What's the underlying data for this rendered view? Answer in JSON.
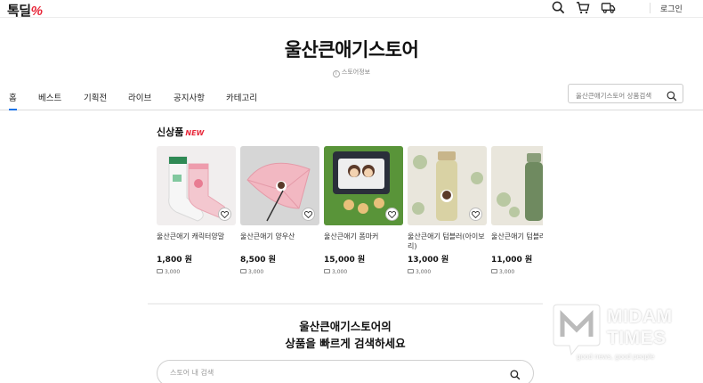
{
  "header": {
    "logo_text": "톡딜",
    "logo_mark": "%",
    "login_label": "로그인",
    "icons": [
      "search-icon",
      "cart-icon",
      "delivery-truck-icon"
    ]
  },
  "store": {
    "title": "울산큰애기스토어",
    "info_label": "스토어정보"
  },
  "nav": {
    "tabs": [
      {
        "label": "홈",
        "active": true
      },
      {
        "label": "베스트"
      },
      {
        "label": "기획전"
      },
      {
        "label": "라이브"
      },
      {
        "label": "공지사항"
      },
      {
        "label": "카테고리"
      }
    ],
    "search_placeholder": "울산큰애기스토어 상품검색"
  },
  "new_products": {
    "title": "신상품",
    "badge": "NEW",
    "items": [
      {
        "name": "울산큰애기 캐릭터양말",
        "price": "1,800 원",
        "shipping": "3,000"
      },
      {
        "name": "울산큰애기 양우산",
        "price": "8,500 원",
        "shipping": "3,000"
      },
      {
        "name": "울산큰애기 폼마커",
        "price": "15,000 원",
        "shipping": "3,000"
      },
      {
        "name": "울산큰애기 텀블러(아이보리)",
        "price": "13,000 원",
        "shipping": "3,000"
      },
      {
        "name": "울산큰애기 텀블러",
        "price": "11,000 원",
        "shipping": "3,000"
      }
    ]
  },
  "bottom_search": {
    "heading_line1": "울산큰애기스토어의",
    "heading_line2": "상품을 빠르게 검색하세요",
    "placeholder": "스토어 내 검색"
  },
  "watermark": {
    "line1": "MIDAM",
    "line2": "TIMES",
    "tagline": "good news, good people"
  },
  "colors": {
    "accent": "#e8283a",
    "active_tab": "#1a73e8"
  }
}
